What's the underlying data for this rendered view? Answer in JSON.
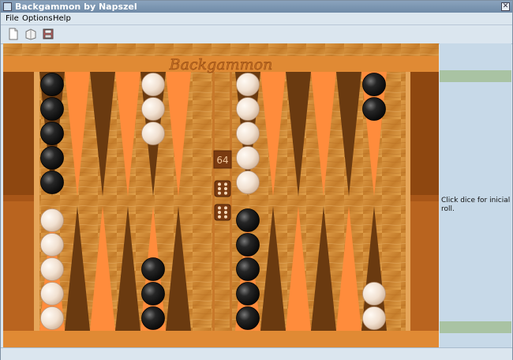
{
  "window": {
    "title": "Backgammon by Napszel"
  },
  "menu": {
    "items": [
      "File",
      "Options",
      "Help"
    ]
  },
  "toolbar": {
    "icons": [
      "new-game-icon",
      "open-icon",
      "save-icon"
    ]
  },
  "board": {
    "title": "Backgammon",
    "doubling_cube": "64",
    "dice": [
      6,
      6
    ],
    "colors": {
      "wood": "#d08a3a",
      "frame": "#c06d1e",
      "dark_point": "#6a3a10",
      "light_point": "#ff8c3c",
      "black_checker": "#1b1b1b",
      "white_checker": "#f1e2d4"
    },
    "points": [
      {
        "index": 1,
        "color": "white",
        "count": 2
      },
      {
        "index": 6,
        "color": "black",
        "count": 5
      },
      {
        "index": 8,
        "color": "black",
        "count": 3
      },
      {
        "index": 12,
        "color": "white",
        "count": 5
      },
      {
        "index": 13,
        "color": "black",
        "count": 5
      },
      {
        "index": 17,
        "color": "white",
        "count": 3
      },
      {
        "index": 19,
        "color": "white",
        "count": 5
      },
      {
        "index": 24,
        "color": "black",
        "count": 2
      }
    ]
  },
  "sidebar": {
    "status": "Click dice for inicial roll."
  }
}
